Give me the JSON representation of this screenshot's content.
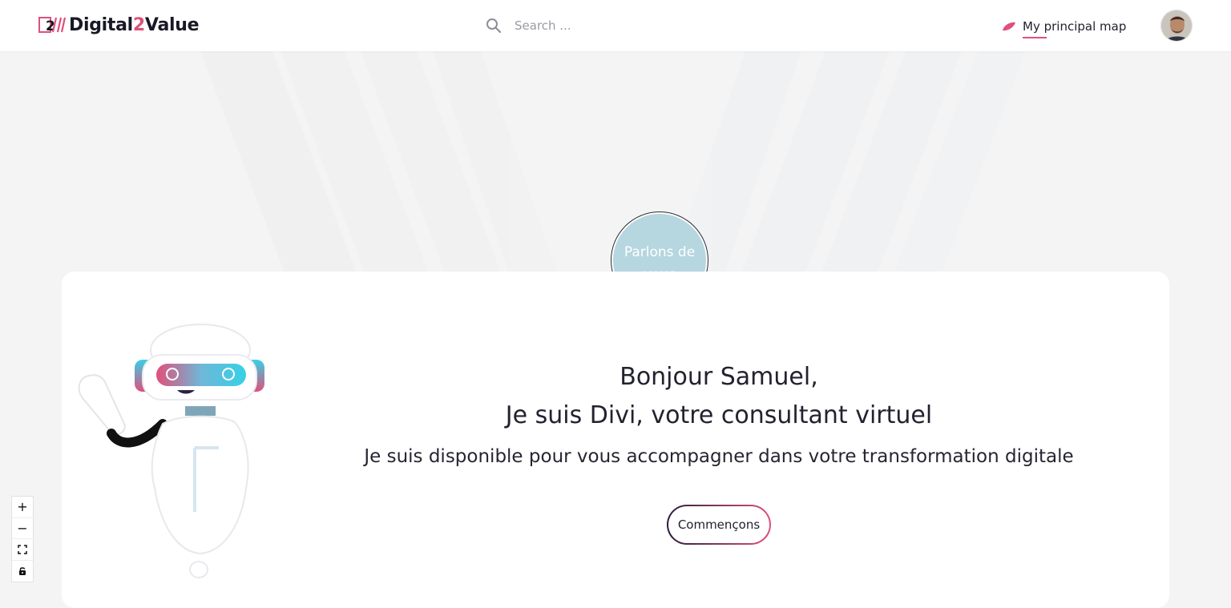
{
  "brand": {
    "name_part1": "Digital",
    "name_accent": "2",
    "name_part2": "Value",
    "accent_color": "#e0507a"
  },
  "search": {
    "placeholder": "Search ..."
  },
  "nav": {
    "map_label": "My principal map"
  },
  "bubble": {
    "label": "Parlons de vous"
  },
  "hero": {
    "greeting_line1": "Bonjour Samuel,",
    "greeting_line2": "Je suis Divi, votre consultant virtuel",
    "subtitle": "Je suis disponible pour vous accompagner dans votre transformation digitale",
    "cta_label": "Commençons"
  },
  "zoom_controls": {
    "zoom_in": "+",
    "zoom_out": "−"
  },
  "icons": {
    "search": "search-icon",
    "map_leaf": "leaf-icon",
    "fit": "fit-view-icon",
    "lock": "lock-icon"
  }
}
